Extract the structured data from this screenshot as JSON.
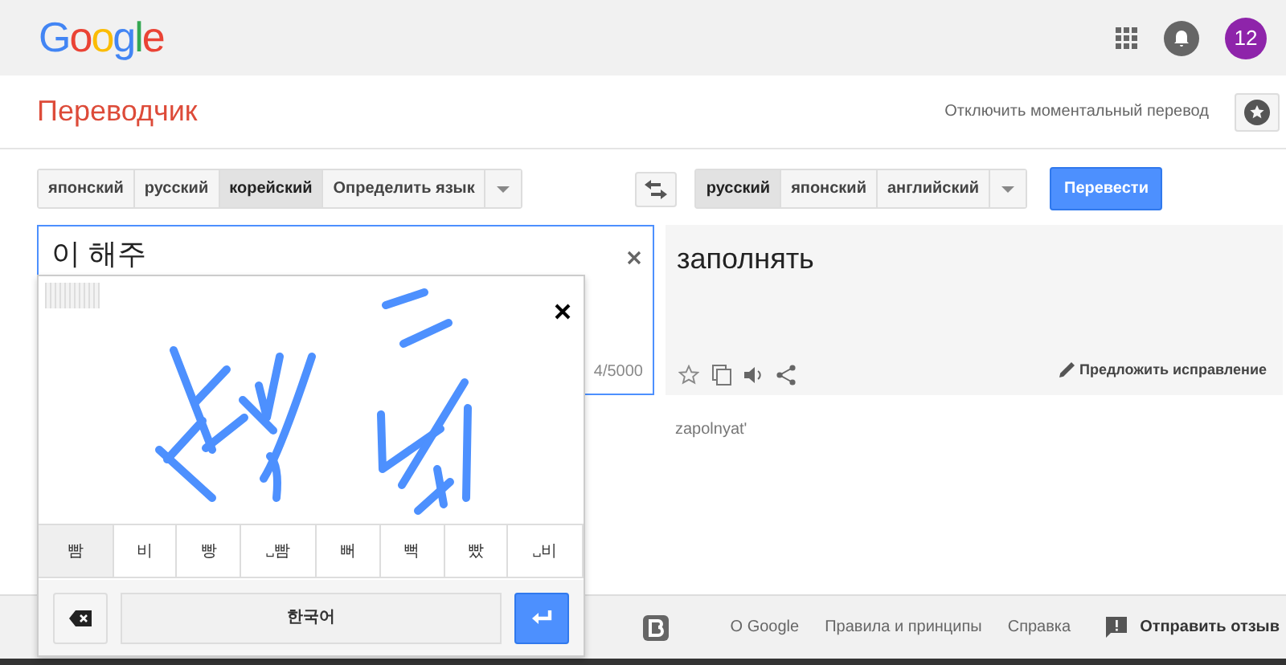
{
  "header": {
    "logo": "Google",
    "apps_count": "12"
  },
  "subheader": {
    "title": "Переводчик",
    "instant_toggle": "Отключить моментальный перевод"
  },
  "source_languages": [
    {
      "label": "японский",
      "selected": false
    },
    {
      "label": "русский",
      "selected": false
    },
    {
      "label": "корейский",
      "selected": true
    },
    {
      "label": "Определить язык",
      "selected": false
    }
  ],
  "target_languages": [
    {
      "label": "русский",
      "selected": true
    },
    {
      "label": "японский",
      "selected": false
    },
    {
      "label": "английский",
      "selected": false
    }
  ],
  "translate_button": "Перевести",
  "source": {
    "value": "이 해주",
    "char_count": "4/5000"
  },
  "target": {
    "text": "заполнять",
    "suggest_edit": "Предложить исправление",
    "romanization": "zapolnyat'"
  },
  "handwriting": {
    "candidates": [
      {
        "label": "빰",
        "selected": true
      },
      {
        "label": "비",
        "selected": false
      },
      {
        "label": "빵",
        "selected": false
      },
      {
        "label": "␣빰",
        "selected": false
      },
      {
        "label": "뻐",
        "selected": false
      },
      {
        "label": "뻑",
        "selected": false
      },
      {
        "label": "빴",
        "selected": false
      },
      {
        "label": "␣비",
        "selected": false
      }
    ],
    "language_key": "한국어"
  },
  "footer": {
    "links": [
      "О Google",
      "Правила и принципы",
      "Справка"
    ],
    "feedback": "Отправить отзыв"
  }
}
